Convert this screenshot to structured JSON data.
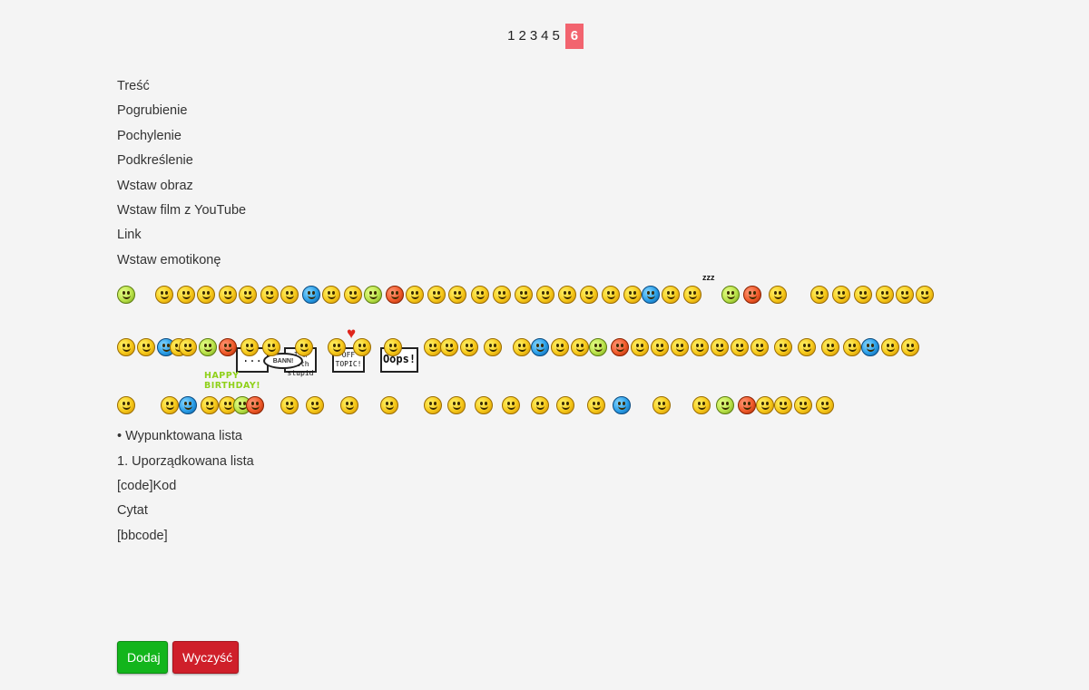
{
  "pagination": {
    "pages": [
      "1",
      "2",
      "3",
      "4",
      "5",
      "6"
    ],
    "active": "6"
  },
  "editor": {
    "content_label": "Treść",
    "tools": [
      "Pogrubienie",
      "Pochylenie",
      "Podkreślenie",
      "Wstaw obraz",
      "Wstaw film z YouTube",
      "Link",
      "Wstaw emotikonę"
    ],
    "tools_after": [
      "• Wypunktowana lista",
      "1. Uporządkowana lista",
      "[code]Kod",
      "Cytat",
      "[bbcode]"
    ],
    "icon_glyph": ""
  },
  "emoticon_signs": {
    "dots": "...",
    "stupid": "I'm with stupid",
    "offtopic": "OFF TOPIC!",
    "oops": "Oops!",
    "bann": "BANN!",
    "birthday_line1": "HAPPY",
    "birthday_line2": "BIRTHDAY!",
    "zzz": "zzz"
  },
  "buttons": {
    "add": "Dodaj",
    "clear": "Wyczyść"
  },
  "colors": {
    "active_page": "#f2646f",
    "add_button": "#13b51c",
    "clear_button": "#cf1f2a",
    "background": "#f4f4f4"
  }
}
